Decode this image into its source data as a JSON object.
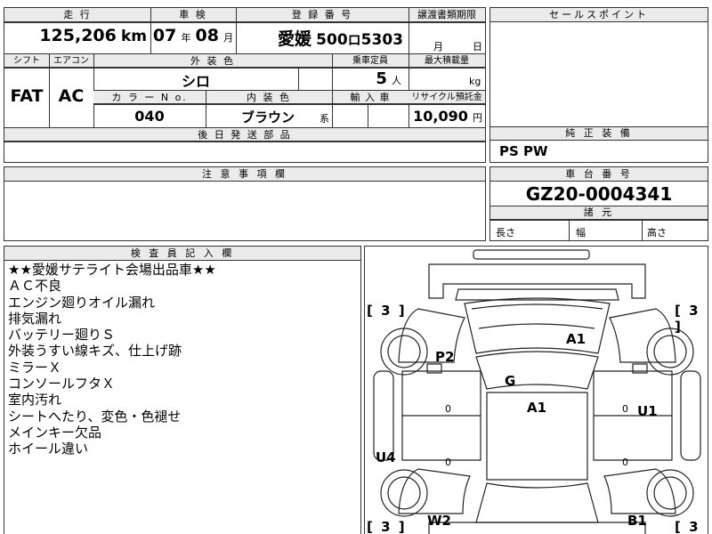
{
  "headers": {
    "mileage": "走 行",
    "inspection": "車 検",
    "registration": "登 録 番 号",
    "transfer_deadline": "譲渡書類期限",
    "sales_point": "セールスポイント",
    "shift": "シフト",
    "aircon": "エアコン",
    "exterior_color": "外 装 色",
    "capacity": "乗車定員",
    "max_load": "最大積載量",
    "color_no": "カ ラ ー N o.",
    "interior_color": "内 装 色",
    "import": "輸 入 車",
    "recycle": "リサイクル預託金",
    "later_parts": "後 日 発 送 部 品",
    "genuine_equipment": "純 正 装 備",
    "caution": "注 意 事 項 欄",
    "chassis_no": "車 台 番 号",
    "dimensions": "諸 元",
    "inspector_notes": "検 査 員 記 入 欄"
  },
  "values": {
    "mileage": "125,206",
    "mileage_unit": "km",
    "inspection_year": "07",
    "inspection_year_unit": "年",
    "inspection_month": "08",
    "inspection_month_unit": "月",
    "reg_region": "愛媛",
    "reg_class": "500",
    "reg_kana": "ロ",
    "reg_number": "5303",
    "transfer_month_unit": "月",
    "transfer_day_unit": "日",
    "shift": "FAT",
    "aircon": "AC",
    "exterior_color": "シロ",
    "capacity": "5",
    "capacity_unit": "人",
    "max_load_unit": "kg",
    "color_no": "040",
    "interior_color": "ブラウン",
    "interior_suffix": "系",
    "recycle": "10,090",
    "recycle_unit": "円",
    "genuine_equipment": "PS PW",
    "chassis_no": "GZ20-0004341",
    "length_label": "長さ",
    "width_label": "幅",
    "height_label": "高さ"
  },
  "notes": [
    "★★愛媛サテライト会場出品車★★",
    "ＡＣ不良",
    "エンジン廻りオイル漏れ",
    "排気漏れ",
    "バッテリー廻りＳ",
    "外装うすい線キズ、仕上げ跡",
    "ミラーＸ",
    "コンソールフタＸ",
    "室内汚れ",
    "シートへたり、変色・色褪せ",
    "メインキー欠品",
    "ホイール違い"
  ],
  "diagram": {
    "marks": [
      "A1",
      "P2",
      "G",
      "A1",
      "U1",
      "U4",
      "W2",
      "B1"
    ],
    "tire_tread": [
      "3",
      "3",
      "3",
      "3"
    ],
    "gauge_zeros": [
      "0",
      "0",
      "0",
      "0"
    ]
  }
}
